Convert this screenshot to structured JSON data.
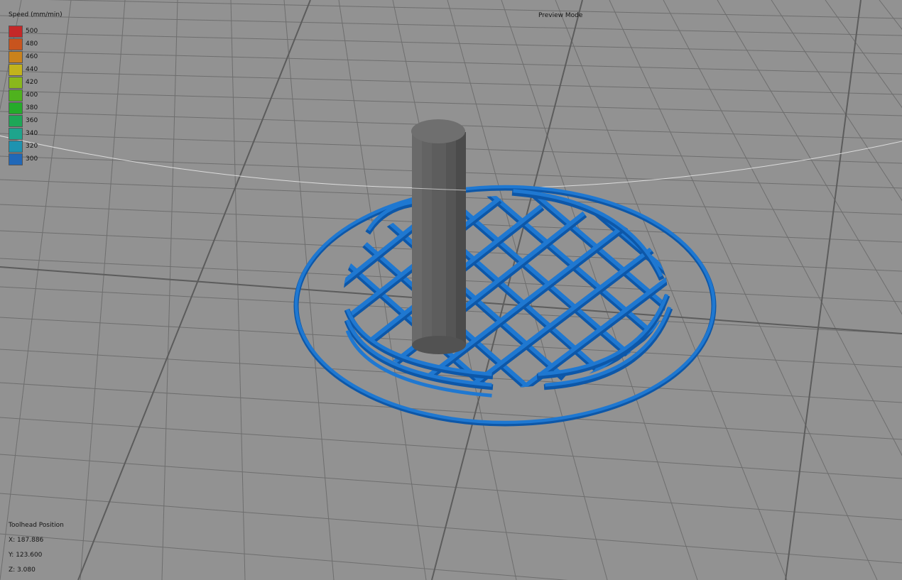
{
  "header": {
    "mode_label": "Preview Mode"
  },
  "legend": {
    "title": "Speed (mm/min)",
    "items": [
      {
        "label": "500",
        "color": "#c42828"
      },
      {
        "label": "480",
        "color": "#c8541e"
      },
      {
        "label": "460",
        "color": "#c9821c"
      },
      {
        "label": "440",
        "color": "#c2b31c"
      },
      {
        "label": "420",
        "color": "#8ab81c"
      },
      {
        "label": "400",
        "color": "#4fb21e"
      },
      {
        "label": "380",
        "color": "#25ab2a"
      },
      {
        "label": "360",
        "color": "#1ea757"
      },
      {
        "label": "340",
        "color": "#1ea48c"
      },
      {
        "label": "320",
        "color": "#1e93b0"
      },
      {
        "label": "300",
        "color": "#2168b8"
      }
    ]
  },
  "toolhead": {
    "title": "Toolhead Position",
    "x": "X: 187.886",
    "y": "Y: 123.600",
    "z": "Z: 3.080"
  },
  "colors": {
    "background": "#929292",
    "grid_line": "#6e6e6e",
    "toolpath": "#1f78d1",
    "toolpath_shade": "#0d57a8",
    "model": "#5a5a5a"
  }
}
